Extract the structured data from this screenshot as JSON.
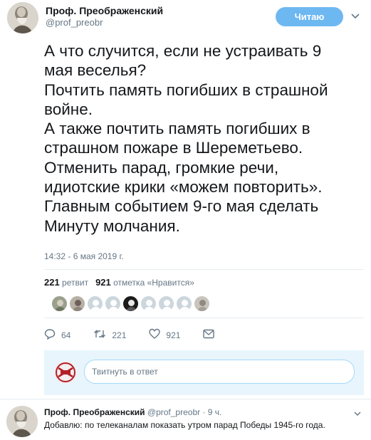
{
  "tweet": {
    "author_name": "Проф. Преображенский",
    "author_handle": "@prof_preobr",
    "follow_label": "Читаю",
    "text": "А что случится, если не устраивать 9\nмая веселья?\nПочтить память погибших в страшной\nвойне.\nА также почтить память погибших в\nстрашном пожаре в Шереметьево.\nОтменить парад, громкие речи,\nидиотские крики «можем повторить».\nГлавным событием 9-го мая сделать\nМинуту молчания.",
    "timestamp": "14:32 - 6 мая 2019 г.",
    "retweets_count": "221",
    "retweets_label": "ретвит",
    "likes_count": "921",
    "likes_label": "отметка «Нравится»",
    "liker_count_shown": 9,
    "actions": {
      "reply_count": "64",
      "retweet_count": "221",
      "like_count": "921"
    }
  },
  "reply_box": {
    "placeholder": "Твитнуть в ответ"
  },
  "reply_tweet": {
    "author_name": "Проф. Преображенский",
    "meta": "@prof_preobr · 9 ч.",
    "text": "Добавлю: по телеканалам показать утром парад Победы 1945-го года."
  },
  "colors": {
    "accent": "#1da1f2",
    "follow_button": "#6eb8f2",
    "reply_box_bg": "#e8f5fd",
    "secondary_text": "#657786"
  }
}
